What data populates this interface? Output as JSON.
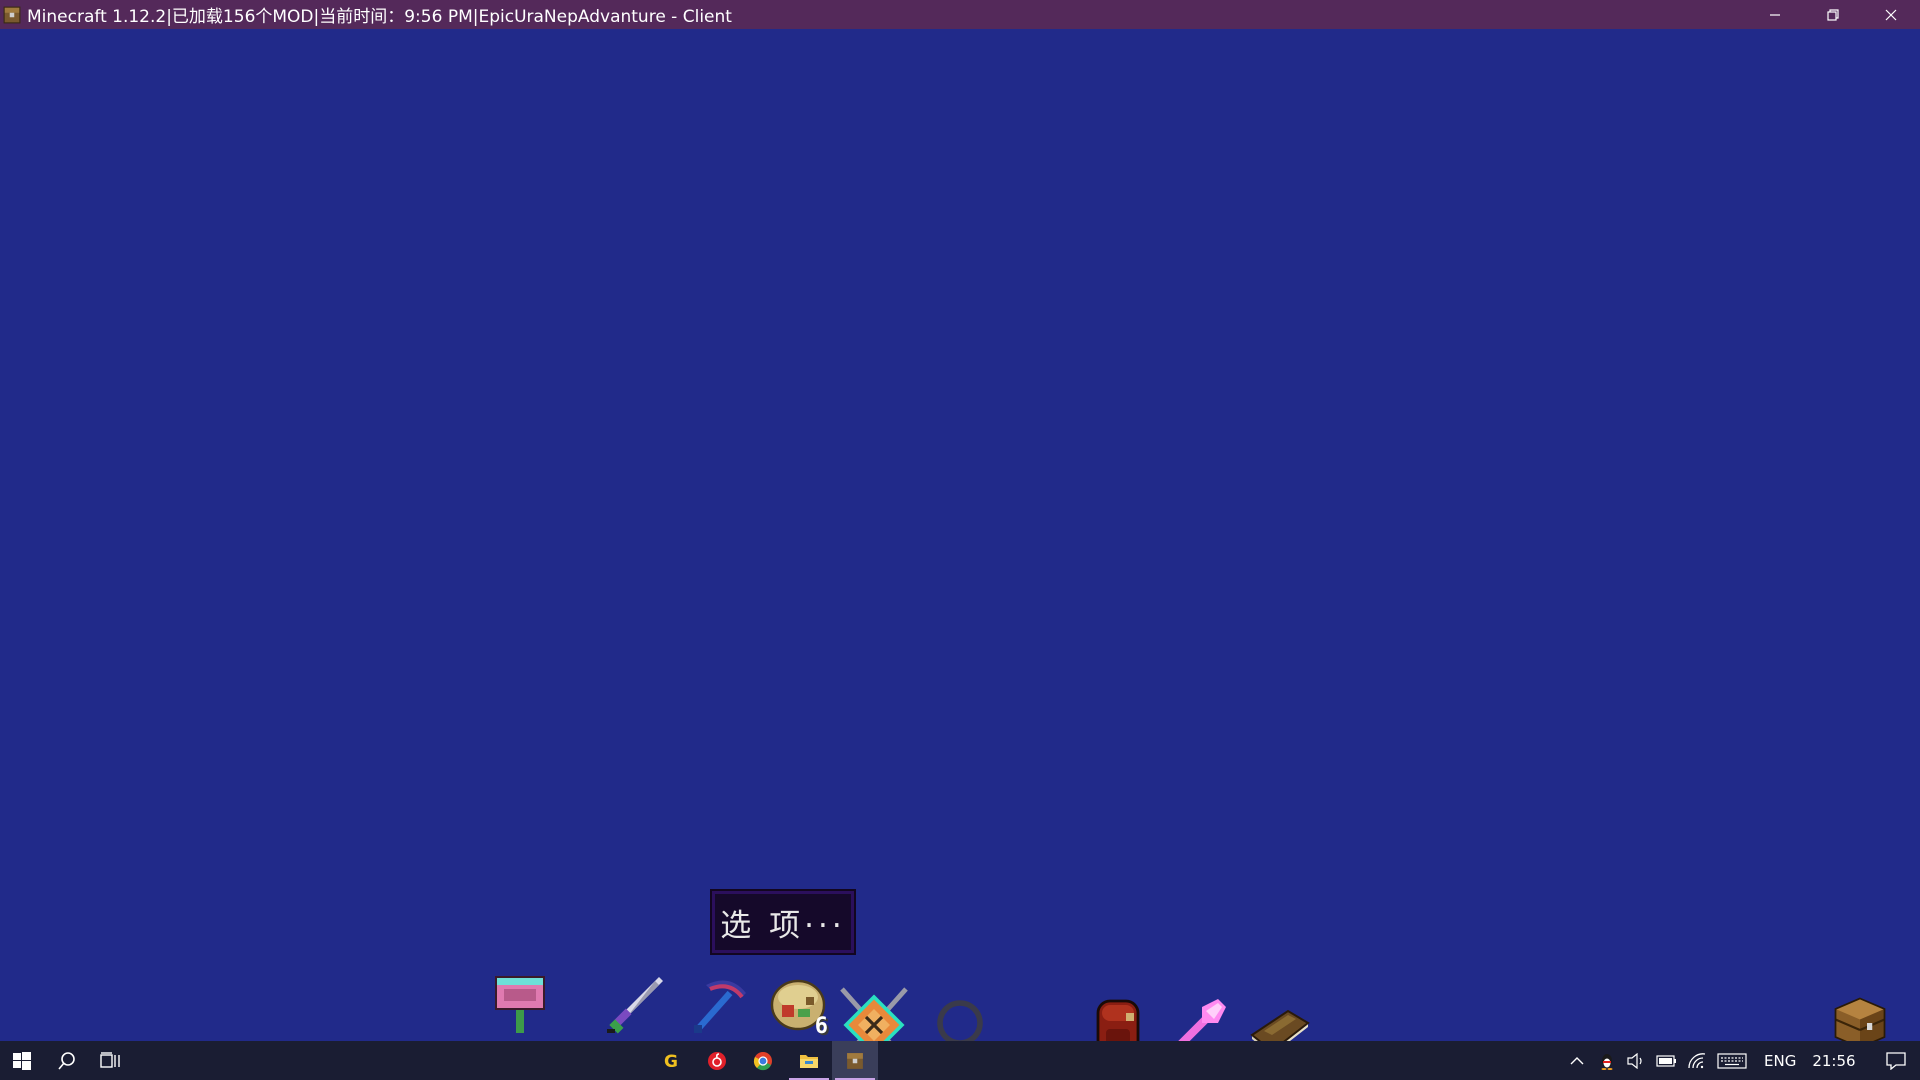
{
  "window": {
    "title": "Minecraft 1.12.2|已加载156个MOD|当前时间：9:56 PM|EpicUraNepAdvanture - Client",
    "minimize_icon": "minimize-icon",
    "restore_icon": "restore-icon",
    "close_icon": "close-icon"
  },
  "game": {
    "background_color": "#212a8a",
    "tooltip_text": "选 项···",
    "hotbar": [
      {
        "name": "signboard-item",
        "icon": "pink-sign-icon"
      },
      {
        "name": "sword-item",
        "icon": "purple-sword-icon"
      },
      {
        "name": "pickaxe-item",
        "icon": "blue-pickaxe-icon"
      },
      {
        "name": "food-bundle-item",
        "icon": "food-bundle-icon",
        "count": "6"
      },
      {
        "name": "crossed-weapons-item",
        "icon": "crossed-swords-shield-icon"
      },
      {
        "name": "empty-ring-item",
        "icon": "grey-ring-icon"
      },
      {
        "name": "backpack-item",
        "icon": "red-backpack-icon"
      },
      {
        "name": "magic-wand-item",
        "icon": "pink-wand-icon"
      },
      {
        "name": "book-item",
        "icon": "brown-book-icon"
      }
    ],
    "chest_icon": "wooden-chest-icon"
  },
  "taskbar": {
    "start_icon": "windows-start-icon",
    "search_icon": "search-icon",
    "taskview_icon": "task-view-icon",
    "apps": [
      {
        "name": "app-g",
        "icon": "g-app-icon"
      },
      {
        "name": "netease-music",
        "icon": "netease-music-icon"
      },
      {
        "name": "chrome",
        "icon": "chrome-icon"
      },
      {
        "name": "file-explorer",
        "icon": "file-explorer-icon"
      },
      {
        "name": "minecraft",
        "icon": "minecraft-icon"
      }
    ],
    "tray": {
      "language": "ENG",
      "time": "21:56"
    },
    "accent_color": "#c9a3e6"
  }
}
